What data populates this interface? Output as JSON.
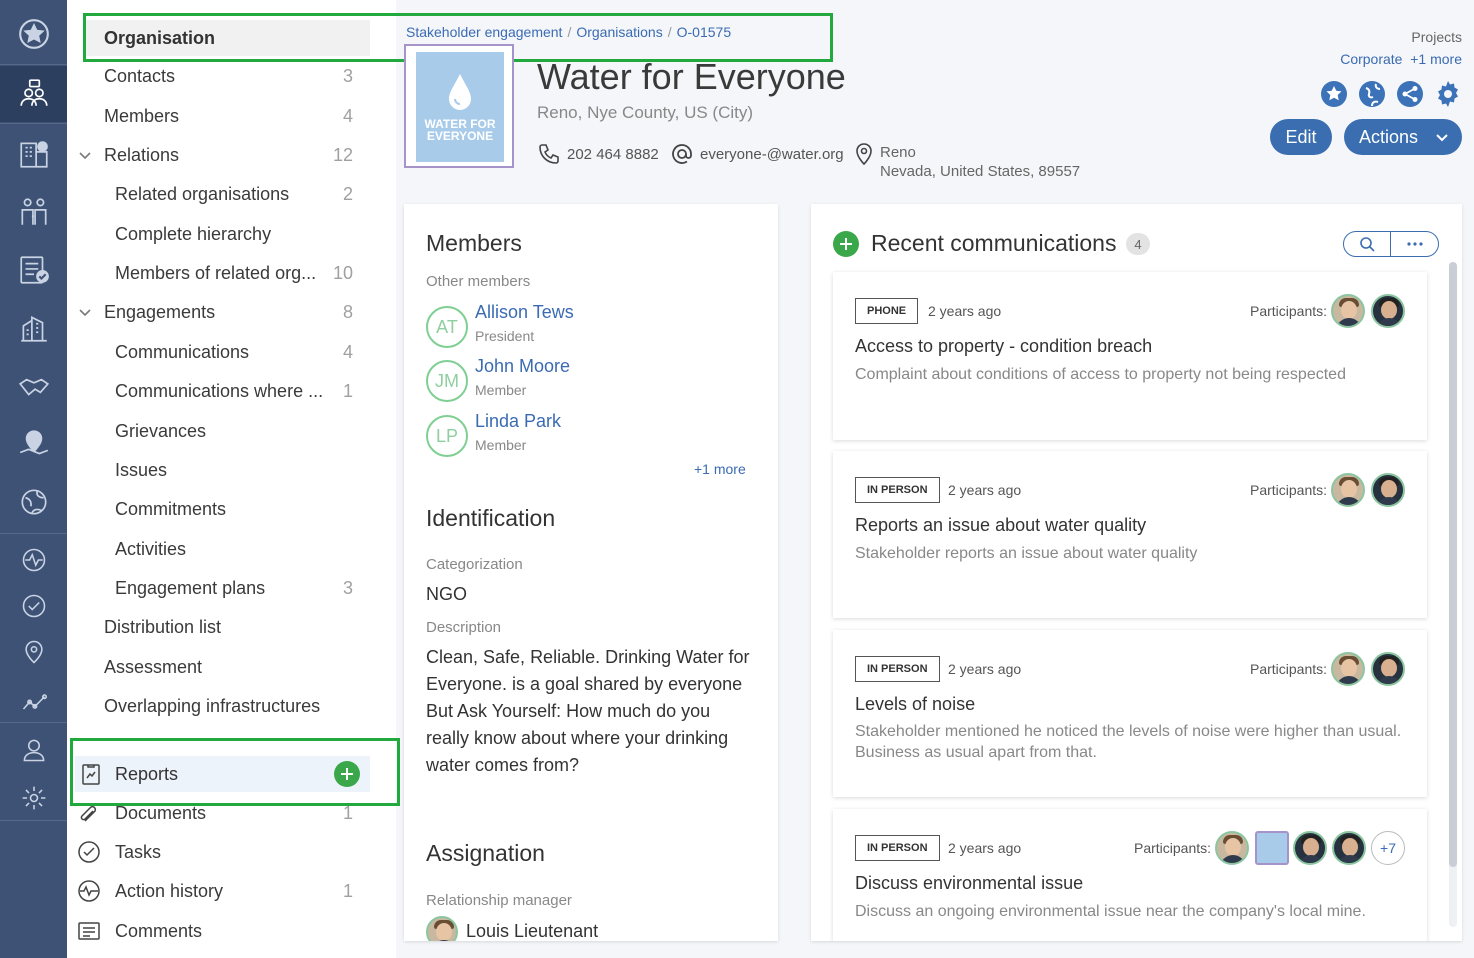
{
  "rail": {
    "icons": [
      "favorites-icon",
      "stakeholders-icon",
      "buildings-icon",
      "people-icon",
      "checklist-icon",
      "city-icon",
      "handshake-icon",
      "map-pin-icon",
      "land-icon",
      "activity-icon",
      "check-icon",
      "location-icon",
      "analytics-icon",
      "user-icon",
      "settings-icon"
    ]
  },
  "nav": {
    "header": "Organisation",
    "items": [
      {
        "label": "Contacts",
        "count": "3"
      },
      {
        "label": "Members",
        "count": "4"
      },
      {
        "label": "Relations",
        "count": "12"
      },
      {
        "label": "Related organisations",
        "count": "2"
      },
      {
        "label": "Complete hierarchy",
        "count": ""
      },
      {
        "label": "Members of related org...",
        "count": "10"
      },
      {
        "label": "Engagements",
        "count": "8"
      },
      {
        "label": "Communications",
        "count": "4"
      },
      {
        "label": "Communications where ...",
        "count": "1"
      },
      {
        "label": "Grievances",
        "count": ""
      },
      {
        "label": "Issues",
        "count": ""
      },
      {
        "label": "Commitments",
        "count": ""
      },
      {
        "label": "Activities",
        "count": ""
      },
      {
        "label": "Engagement plans",
        "count": "3"
      },
      {
        "label": "Distribution list",
        "count": ""
      },
      {
        "label": "Assessment",
        "count": ""
      },
      {
        "label": "Overlapping infrastructures",
        "count": ""
      }
    ],
    "reports": "Reports",
    "bottom": [
      {
        "label": "Documents",
        "count": "1"
      },
      {
        "label": "Tasks",
        "count": ""
      },
      {
        "label": "Action history",
        "count": "1"
      },
      {
        "label": "Comments",
        "count": ""
      }
    ]
  },
  "breadcrumb": [
    "Stakeholder engagement",
    "Organisations",
    "O-01575"
  ],
  "org": {
    "logo_text_1": "WATER FOR",
    "logo_text_2": "EVERYONE",
    "title": "Water for Everyone",
    "subtitle": "Reno, Nye County, US (City)",
    "phone": "202 464 8882",
    "email": "everyone-@water.org",
    "address_line1": "Reno",
    "address_line2": "Nevada, United States, 89557"
  },
  "projects": {
    "label": "Projects",
    "value": "Corporate",
    "more": "+1 more"
  },
  "buttons": {
    "edit": "Edit",
    "actions": "Actions"
  },
  "members_card": {
    "title": "Members",
    "other_label": "Other members",
    "people": [
      {
        "initials": "AT",
        "name": "Allison Tews",
        "role": "President"
      },
      {
        "initials": "JM",
        "name": "John Moore",
        "role": "Member"
      },
      {
        "initials": "LP",
        "name": "Linda Park",
        "role": "Member"
      }
    ],
    "more": "+1 more",
    "identification_title": "Identification",
    "categorization_label": "Categorization",
    "categorization_value": "NGO",
    "description_label": "Description",
    "description": "Clean, Safe, Reliable. Drinking Water for Everyone. is a goal shared by everyone But Ask Yourself: How much do you really know about where your drinking water comes from?",
    "assignation_title": "Assignation",
    "manager_label": "Relationship manager",
    "manager_name": "Louis Lieutenant"
  },
  "comms": {
    "title": "Recent communications",
    "count": "4",
    "items": [
      {
        "type": "PHONE",
        "when": "2 years ago",
        "participants_label": "Participants:",
        "title": "Access to property - condition breach",
        "desc": "Complaint about conditions of access to property not being respected"
      },
      {
        "type": "IN PERSON",
        "when": "2 years ago",
        "participants_label": "Participants:",
        "title": "Reports an issue about water quality",
        "desc": "Stakeholder reports an issue about water quality"
      },
      {
        "type": "IN PERSON",
        "when": "2 years ago",
        "participants_label": "Participants:",
        "title": "Levels of noise",
        "desc": "Stakeholder mentioned he noticed the levels of noise were higher than usual. Business as usual apart from that."
      },
      {
        "type": "IN PERSON",
        "when": "2 years ago",
        "participants_label": "Participants:",
        "title": "Discuss environmental issue",
        "desc": "Discuss an ongoing environmental issue near the company's local mine.",
        "more_participants": "+7"
      }
    ]
  },
  "colors": {
    "accent": "#3a6eb0",
    "highlight": "#22a93d",
    "rail": "#3d5275"
  }
}
